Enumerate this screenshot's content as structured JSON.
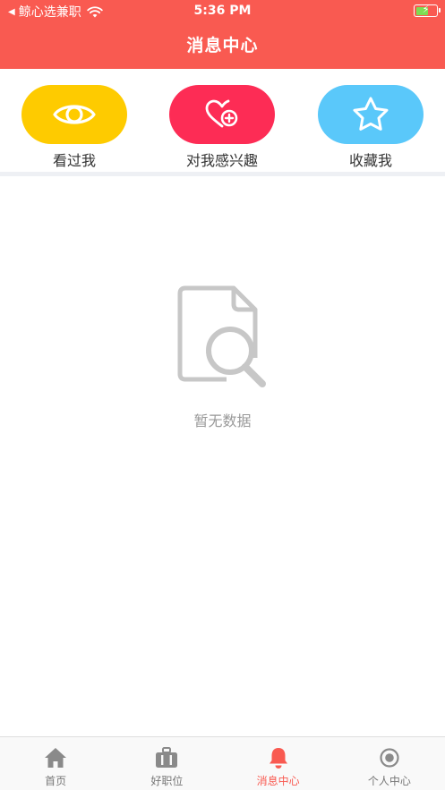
{
  "status_bar": {
    "carrier": "鲸心选兼职",
    "time": "5:36 PM"
  },
  "nav": {
    "title": "消息中心"
  },
  "shortcuts": [
    {
      "label": "看过我",
      "icon": "eye-icon",
      "color": "#fecb00"
    },
    {
      "label": "对我感兴趣",
      "icon": "heart-plus-icon",
      "color": "#fd2c55"
    },
    {
      "label": "收藏我",
      "icon": "star-icon",
      "color": "#5ac8fa"
    }
  ],
  "empty_state": {
    "icon": "document-search-icon",
    "text": "暂无数据"
  },
  "tabbar": {
    "active_color": "#f95a51",
    "items": [
      {
        "label": "首页",
        "icon": "home-icon",
        "active": false
      },
      {
        "label": "好职位",
        "icon": "briefcase-icon",
        "active": false
      },
      {
        "label": "消息中心",
        "icon": "bell-icon",
        "active": true
      },
      {
        "label": "个人中心",
        "icon": "profile-icon",
        "active": false
      }
    ]
  },
  "colors": {
    "header": "#f95a51",
    "divider": "#eef0f4"
  }
}
